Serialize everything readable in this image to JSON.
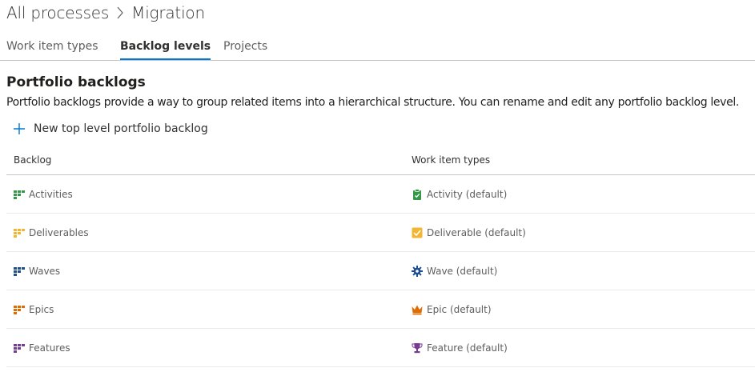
{
  "breadcrumb": {
    "root": "All processes",
    "separator": ">",
    "current": "Migration"
  },
  "tabs": [
    {
      "label": "Work item types",
      "active": false
    },
    {
      "label": "Backlog levels",
      "active": true
    },
    {
      "label": "Projects",
      "active": false
    }
  ],
  "section": {
    "title": "Portfolio backlogs",
    "description": "Portfolio backlogs provide a way to group related items into a hierarchical structure. You can rename and edit any portfolio backlog level."
  },
  "new_button": {
    "label": "New top level portfolio backlog",
    "icon": "plus-icon"
  },
  "table": {
    "columns": [
      "Backlog",
      "Work item types"
    ],
    "rows": [
      {
        "backlog": "Activities",
        "backlog_color": "#339947",
        "work_item_type": "Activity (default)",
        "wit_icon": "clipboard-check-icon",
        "wit_color": "#339947"
      },
      {
        "backlog": "Deliverables",
        "backlog_color": "#f2b633",
        "work_item_type": "Deliverable (default)",
        "wit_icon": "checkbox-icon",
        "wit_color": "#f2b633"
      },
      {
        "backlog": "Waves",
        "backlog_color": "#1f4e8c",
        "work_item_type": "Wave (default)",
        "wit_icon": "gear-icon",
        "wit_color": "#1f4e8c"
      },
      {
        "backlog": "Epics",
        "backlog_color": "#e06c00",
        "work_item_type": "Epic (default)",
        "wit_icon": "crown-icon",
        "wit_color": "#e06c00"
      },
      {
        "backlog": "Features",
        "backlog_color": "#773b93",
        "work_item_type": "Feature (default)",
        "wit_icon": "trophy-icon",
        "wit_color": "#773b93"
      }
    ]
  },
  "colors": {
    "accent": "#0078d4"
  }
}
